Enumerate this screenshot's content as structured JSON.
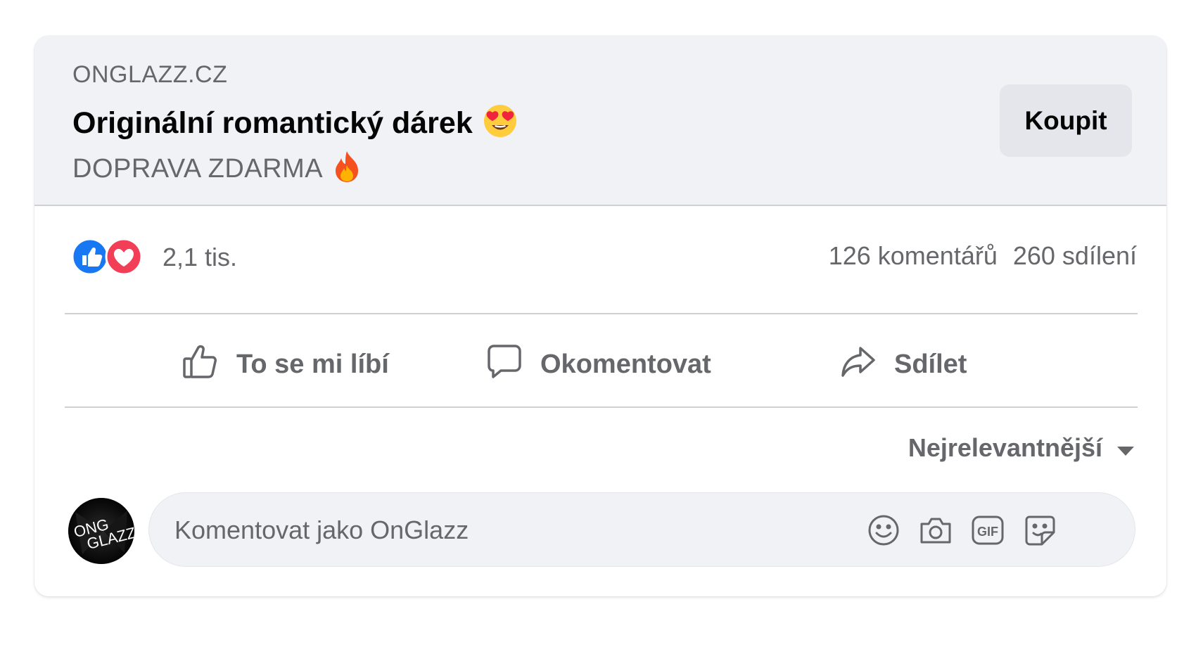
{
  "ad": {
    "domain": "ONGLAZZ.CZ",
    "headline": "Originální romantický dárek",
    "headline_emoji": "heart-eyes-emoji",
    "subline": "DOPRAVA ZDARMA",
    "subline_emoji": "fire-emoji",
    "cta_label": "Koupit"
  },
  "stats": {
    "reactions": [
      "like-reaction-icon",
      "love-reaction-icon"
    ],
    "reaction_count": "2,1 tis.",
    "comments": "126 komentářů",
    "shares": "260 sdílení"
  },
  "actions": [
    {
      "label": "To se mi líbí",
      "icon": "thumbs-up-icon"
    },
    {
      "label": "Okomentovat",
      "icon": "comment-bubble-icon"
    },
    {
      "label": "Sdílet",
      "icon": "share-arrow-icon"
    }
  ],
  "sort": {
    "label": "Nejrelevantnější",
    "icon": "caret-down-icon"
  },
  "composer": {
    "avatar_text": [
      "ONG",
      "GLAZZ"
    ],
    "placeholder": "Komentovat jako OnGlazz",
    "tools": [
      "smiley-icon",
      "camera-icon",
      "gif-icon",
      "sticker-icon"
    ]
  },
  "colors": {
    "secondary_text": "#65676b",
    "like_blue": "#1877f2",
    "love_red": "#f33e58",
    "preview_bg": "#f0f2f5"
  }
}
